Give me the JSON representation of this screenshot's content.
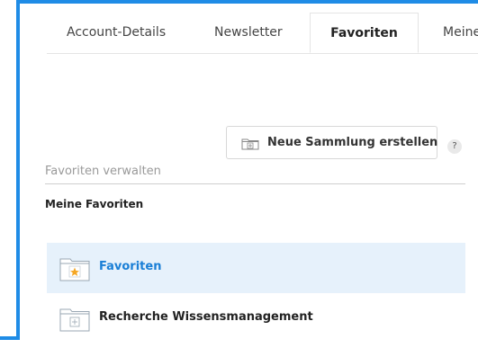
{
  "tabs": [
    {
      "label": "Account-Details",
      "active": false
    },
    {
      "label": "Newsletter",
      "active": false
    },
    {
      "label": "Favoriten",
      "active": true
    },
    {
      "label": "Meine",
      "active": false
    }
  ],
  "toolbar": {
    "create_collection_label": "Neue Sammlung erstellen",
    "help_label": "?"
  },
  "manage": {
    "label": "Favoriten verwalten"
  },
  "favorites": {
    "heading": "Meine Favoriten",
    "items": [
      {
        "label": "Favoriten",
        "icon": "star-folder-icon",
        "selected": true
      },
      {
        "label": "Recherche Wissensmanagement",
        "icon": "folder-icon",
        "selected": false
      }
    ]
  },
  "colors": {
    "accent": "#1f8ce6",
    "selected_bg": "#e6f1fb",
    "selected_text": "#1a7fd6",
    "star": "#f5a623"
  }
}
